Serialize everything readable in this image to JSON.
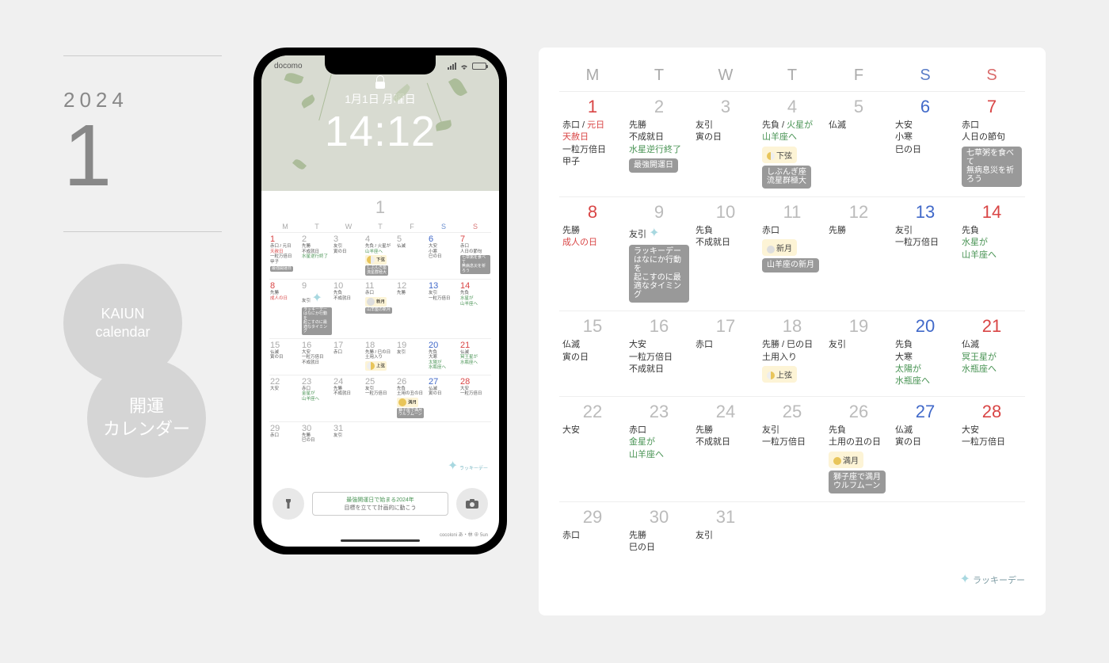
{
  "left": {
    "year": "2024",
    "month": "1",
    "badge1_l1": "KAIUN",
    "badge1_l2": "calendar",
    "badge2_l1": "開運",
    "badge2_l2": "カレンダー"
  },
  "phone": {
    "carrier": "docomo",
    "date": "1月1日 月曜日",
    "time": "14:12",
    "month_big": "1",
    "footer_l1": "最強開運日で始まる2024年",
    "footer_l2": "目標を立てて計画的に動こう",
    "brand": "cocoloni あ・林 ⊕ 5un",
    "lucky": "ラッキーデー"
  },
  "dow": {
    "m": "M",
    "t": "T",
    "w": "W",
    "th": "T",
    "f": "F",
    "sa": "S",
    "su": "S"
  },
  "moon": {
    "lq": "下弦",
    "fq": "上弦",
    "new": "新月",
    "full": "満月"
  },
  "tags": {
    "saikyo": "最強開運日",
    "shibungi": "しぶんぎ座\n流星群極大",
    "nanakusa": "七草粥を食べて\n無病息災を祈ろう",
    "lucky_tip": "ラッキーデーはなにか行動を\n起こすのに最適なタイミング",
    "yagi_new": "山羊座の新月",
    "shishi": "獅子座で満月\nウルフムーン"
  },
  "legend": {
    "lucky": "ラッキーデー"
  },
  "cells": {
    "d1": {
      "n": "1",
      "l1": "赤口 / 元日",
      "l2": "天赦日",
      "l3": "一粒万倍日",
      "l4": "甲子"
    },
    "d2": {
      "n": "2",
      "l1": "先勝",
      "l2": "不成就日",
      "l3": "水星逆行終了"
    },
    "d3": {
      "n": "3",
      "l1": "友引",
      "l2": "寅の日"
    },
    "d4": {
      "n": "4",
      "l1": "先負 / 火星が",
      "l2": "山羊座へ"
    },
    "d5": {
      "n": "5",
      "l1": "仏滅"
    },
    "d6": {
      "n": "6",
      "l1": "大安",
      "l2": "小寒",
      "l3": "巳の日"
    },
    "d7": {
      "n": "7",
      "l1": "赤口",
      "l2": "人日の節句"
    },
    "d8": {
      "n": "8",
      "l1": "先勝",
      "l2": "成人の日"
    },
    "d9": {
      "n": "9",
      "l1": "友引"
    },
    "d10": {
      "n": "10",
      "l1": "先負",
      "l2": "不成就日"
    },
    "d11": {
      "n": "11",
      "l1": "赤口"
    },
    "d12": {
      "n": "12",
      "l1": "先勝"
    },
    "d13": {
      "n": "13",
      "l1": "友引",
      "l2": "一粒万倍日"
    },
    "d14": {
      "n": "14",
      "l1": "先負",
      "l2": "水星が",
      "l3": "山羊座へ"
    },
    "d15": {
      "n": "15",
      "l1": "仏滅",
      "l2": "寅の日"
    },
    "d16": {
      "n": "16",
      "l1": "大安",
      "l2": "一粒万倍日",
      "l3": "不成就日"
    },
    "d17": {
      "n": "17",
      "l1": "赤口"
    },
    "d18": {
      "n": "18",
      "l1": "先勝 / 巳の日",
      "l2": "土用入り"
    },
    "d19": {
      "n": "19",
      "l1": "友引"
    },
    "d20": {
      "n": "20",
      "l1": "先負",
      "l2": "大寒",
      "l3": "太陽が",
      "l4": "水瓶座へ"
    },
    "d21": {
      "n": "21",
      "l1": "仏滅",
      "l2": "冥王星が",
      "l3": "水瓶座へ"
    },
    "d22": {
      "n": "22",
      "l1": "大安"
    },
    "d23": {
      "n": "23",
      "l1": "赤口",
      "l2": "金星が",
      "l3": "山羊座へ"
    },
    "d24": {
      "n": "24",
      "l1": "先勝",
      "l2": "不成就日"
    },
    "d25": {
      "n": "25",
      "l1": "友引",
      "l2": "一粒万倍日"
    },
    "d26": {
      "n": "26",
      "l1": "先負",
      "l2": "土用の丑の日"
    },
    "d27": {
      "n": "27",
      "l1": "仏滅",
      "l2": "寅の日"
    },
    "d28": {
      "n": "28",
      "l1": "大安",
      "l2": "一粒万倍日"
    },
    "d29": {
      "n": "29",
      "l1": "赤口"
    },
    "d30": {
      "n": "30",
      "l1": "先勝",
      "l2": "巳の日"
    },
    "d31": {
      "n": "31",
      "l1": "友引"
    }
  }
}
